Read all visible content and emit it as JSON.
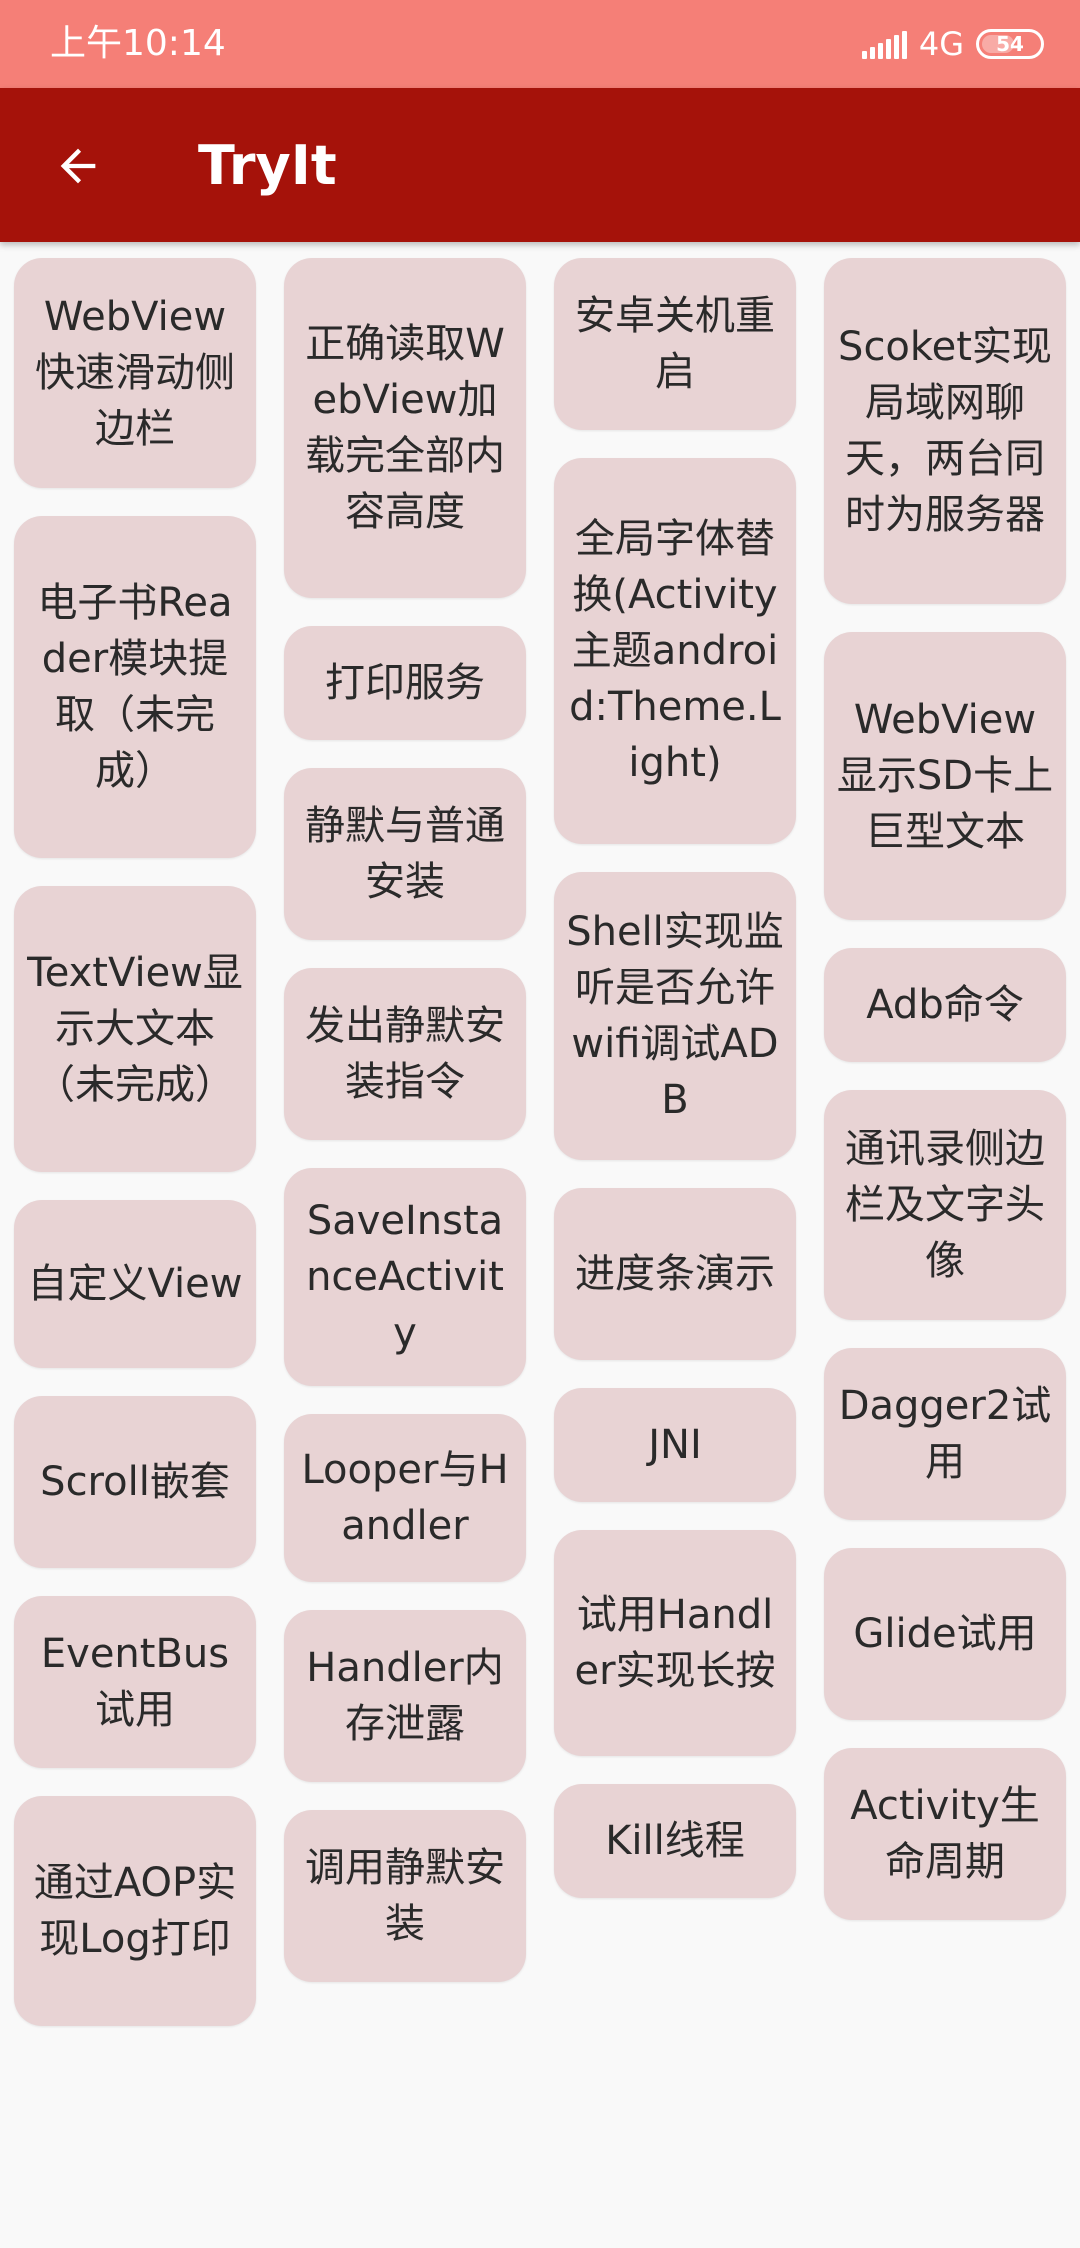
{
  "status_bar": {
    "time": "上午10:14",
    "network": "4G",
    "battery": "54",
    "background_color": "#f57f77"
  },
  "app_bar": {
    "title": "TryIt",
    "back_icon": "arrow-left-icon",
    "background_color": "#a5120a"
  },
  "card_color": "#e8d3d4",
  "columns": [
    {
      "items": [
        {
          "label": "WebView快速滑动侧边栏"
        },
        {
          "label": "电子书Reader模块提取（未完成）"
        },
        {
          "label": "TextView显示大文本（未完成）"
        },
        {
          "label": "自定义View"
        },
        {
          "label": "Scroll嵌套"
        },
        {
          "label": "EventBus试用"
        },
        {
          "label": "通过AOP实现Log打印"
        }
      ]
    },
    {
      "items": [
        {
          "label": "正确读取WebView加载完全部内容高度"
        },
        {
          "label": "打印服务"
        },
        {
          "label": "静默与普通安装"
        },
        {
          "label": "发出静默安装指令"
        },
        {
          "label": "SaveInstanceActivity"
        },
        {
          "label": "Looper与Handler"
        },
        {
          "label": "Handler内存泄露"
        },
        {
          "label": "调用静默安装"
        }
      ]
    },
    {
      "items": [
        {
          "label": "安卓关机重启"
        },
        {
          "label": "全局字体替换(Activity主题android:Theme.Light)"
        },
        {
          "label": "Shell实现监听是否允许wifi调试ADB"
        },
        {
          "label": "进度条演示"
        },
        {
          "label": "JNI"
        },
        {
          "label": "试用Handler实现长按"
        },
        {
          "label": "Kill线程"
        }
      ]
    },
    {
      "items": [
        {
          "label": "Scoket实现局域网聊天，两台同时为服务器"
        },
        {
          "label": "WebView显示SD卡上巨型文本"
        },
        {
          "label": "Adb命令"
        },
        {
          "label": "通讯录侧边栏及文字头像"
        },
        {
          "label": "Dagger2试用"
        },
        {
          "label": "Glide试用"
        },
        {
          "label": "Activity生命周期"
        }
      ]
    }
  ]
}
